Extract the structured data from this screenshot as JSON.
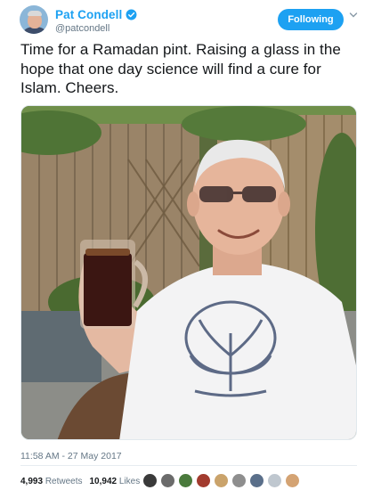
{
  "author": {
    "name": "Pat Condell",
    "handle": "@patcondell",
    "verified": true,
    "avatar_icon": "profile-photo"
  },
  "follow_button": {
    "label": "Following"
  },
  "tweet": {
    "text": "Time for a Ramadan pint. Raising a glass in the hope that one day science will find a cure for Islam. Cheers."
  },
  "photo": {
    "icon": "tweet-photo"
  },
  "timestamp": "11:58 AM - 27 May 2017",
  "stats": {
    "retweets_count": "4,993",
    "retweets_label": "Retweets",
    "likes_count": "10,942",
    "likes_label": "Likes"
  },
  "likers": {
    "colors": [
      "#3a3a3a",
      "#6b6b6b",
      "#4a7a3c",
      "#a23b2e",
      "#caa36b",
      "#8e8e8e",
      "#5a6f8a",
      "#bfc7cf",
      "#d4a373"
    ]
  },
  "colors": {
    "accent": "#1da1f2",
    "text": "#14171a",
    "muted": "#657786"
  }
}
